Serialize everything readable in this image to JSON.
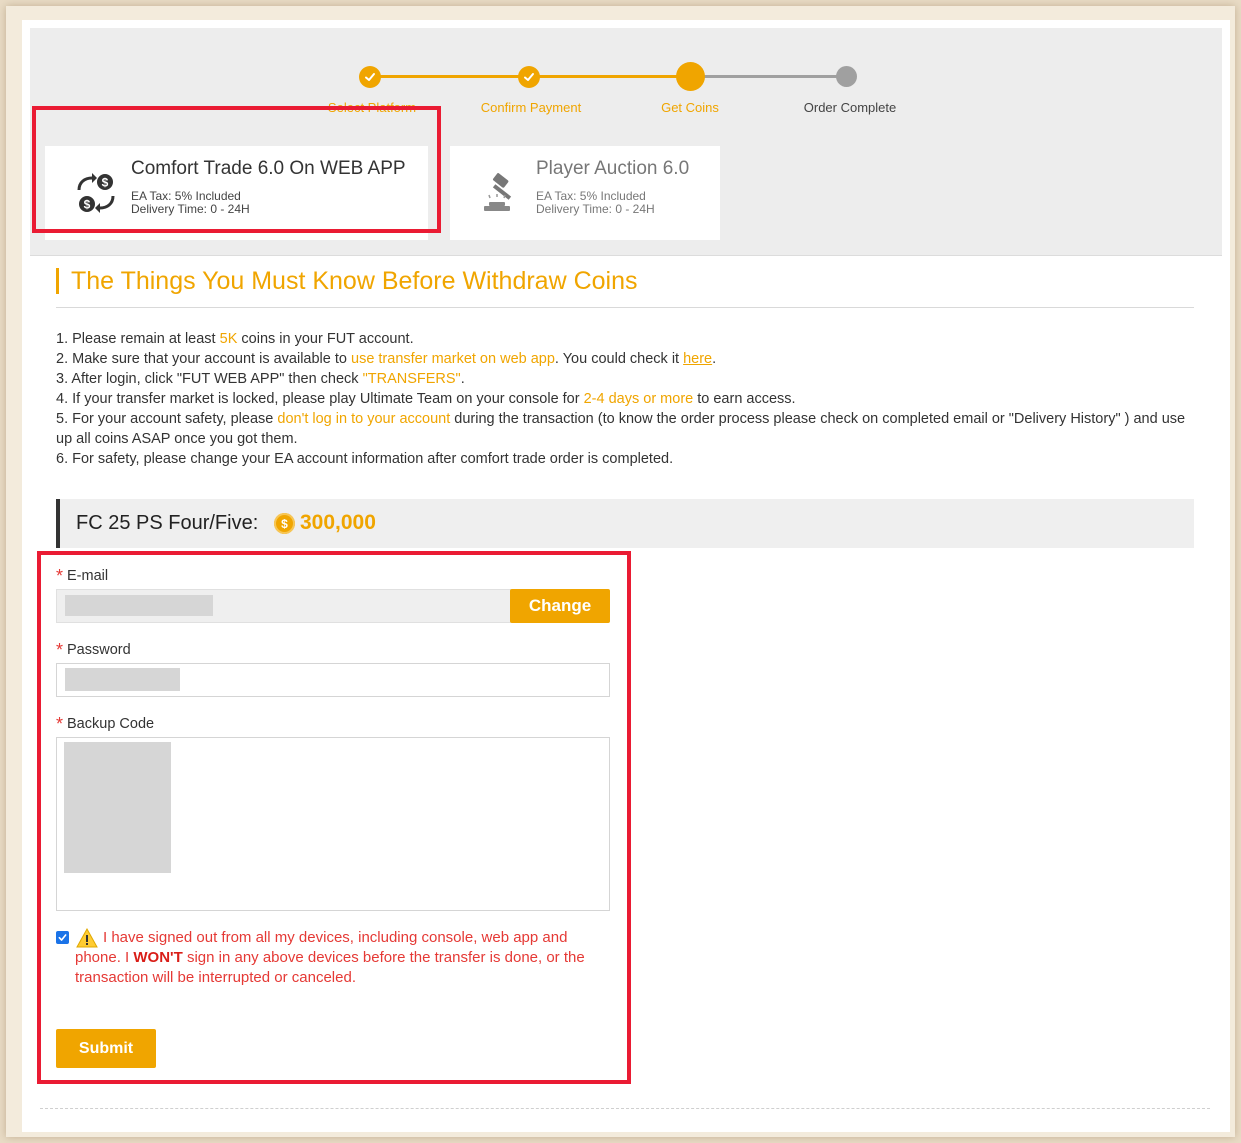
{
  "stepper": {
    "steps": [
      {
        "label": "Select Platform",
        "state": "done"
      },
      {
        "label": "Confirm Payment",
        "state": "done"
      },
      {
        "label": "Get Coins",
        "state": "current"
      },
      {
        "label": "Order Complete",
        "state": "pending"
      }
    ]
  },
  "platforms": [
    {
      "title": "Comfort Trade 6.0 On WEB APP",
      "tax": "EA Tax: 5% Included",
      "delivery": "Delivery Time: 0 - 24H",
      "selected": true,
      "icon": "currency-exchange-icon"
    },
    {
      "title": "Player Auction 6.0",
      "tax": "EA Tax: 5% Included",
      "delivery": "Delivery Time: 0 - 24H",
      "selected": false,
      "icon": "auction-gavel-icon"
    }
  ],
  "notice": {
    "title": "The Things You Must Know Before Withdraw Coins",
    "rule1": {
      "pre": "1. Please remain at least ",
      "hl": "5K",
      "post": " coins in your FUT account."
    },
    "rule2": {
      "pre": "2. Make sure that your account is available to ",
      "hl": "use transfer market on web app",
      "mid": ". You could check it ",
      "link": "here",
      "post": "."
    },
    "rule3": {
      "pre": "3. After login, click \"FUT WEB APP\" then check ",
      "hl": "\"TRANSFERS\"",
      "post": "."
    },
    "rule4": {
      "pre": "4. If your transfer market is locked, please play Ultimate Team on your console for ",
      "hl": "2-4 days or more",
      "post": " to earn access."
    },
    "rule5": {
      "pre": "5. For your account safety, please ",
      "hl": "don't log in to your account",
      "post": " during the transaction (to know the order process please check on completed email or \"Delivery History\" ) and use up all coins ASAP once you got them."
    },
    "rule6": "6. For safety, please change your EA account information after comfort trade order is completed."
  },
  "order": {
    "label": "FC 25 PS Four/Five:",
    "coin_symbol": "$",
    "amount": "300,000"
  },
  "form": {
    "required_mark": "*",
    "email_label": "E-mail",
    "change_label": "Change",
    "password_label": "Password",
    "backup_label": "Backup Code",
    "agree_checked": true,
    "agree_pre": "I have signed out from all my devices, including console, web app and phone. I ",
    "agree_strong": "WON'T",
    "agree_post": " sign in any above devices before the transfer is done, or the transaction will be interrupted or canceled.",
    "submit_label": "Submit"
  },
  "colors": {
    "accent": "#f0a500",
    "highlight_box": "#ea1b33",
    "warning_text": "#e53935",
    "pending_step": "#a0a0a0"
  }
}
